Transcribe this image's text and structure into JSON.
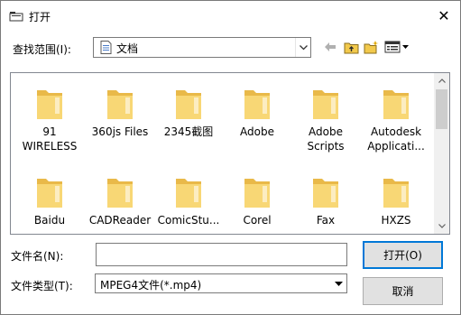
{
  "titlebar": {
    "title": "打开",
    "close_glyph": "✕"
  },
  "lookin": {
    "label": "查找范围(I):",
    "value": "文档"
  },
  "toolbar": {
    "icons": [
      "back-arrow-icon",
      "up-folder-icon",
      "new-folder-icon",
      "view-menu-icon"
    ]
  },
  "folders": [
    {
      "label": "91\nWIRELESS"
    },
    {
      "label": "360js Files"
    },
    {
      "label": "2345截图"
    },
    {
      "label": "Adobe"
    },
    {
      "label": "Adobe\nScripts"
    },
    {
      "label": "Autodesk\nApplicati..."
    },
    {
      "label": "Baidu"
    },
    {
      "label": "CADReader"
    },
    {
      "label": "ComicStu..."
    },
    {
      "label": "Corel"
    },
    {
      "label": "Fax"
    },
    {
      "label": "HXZS"
    }
  ],
  "filename": {
    "label": "文件名(N):",
    "value": "",
    "placeholder": ""
  },
  "filetype": {
    "label": "文件类型(T):",
    "value": "MPEG4文件(*.mp4)"
  },
  "buttons": {
    "open": "打开(O)",
    "cancel": "取消"
  },
  "colors": {
    "folder_light": "#f8d775",
    "folder_dark": "#e9b949",
    "accent": "#0078d7"
  }
}
